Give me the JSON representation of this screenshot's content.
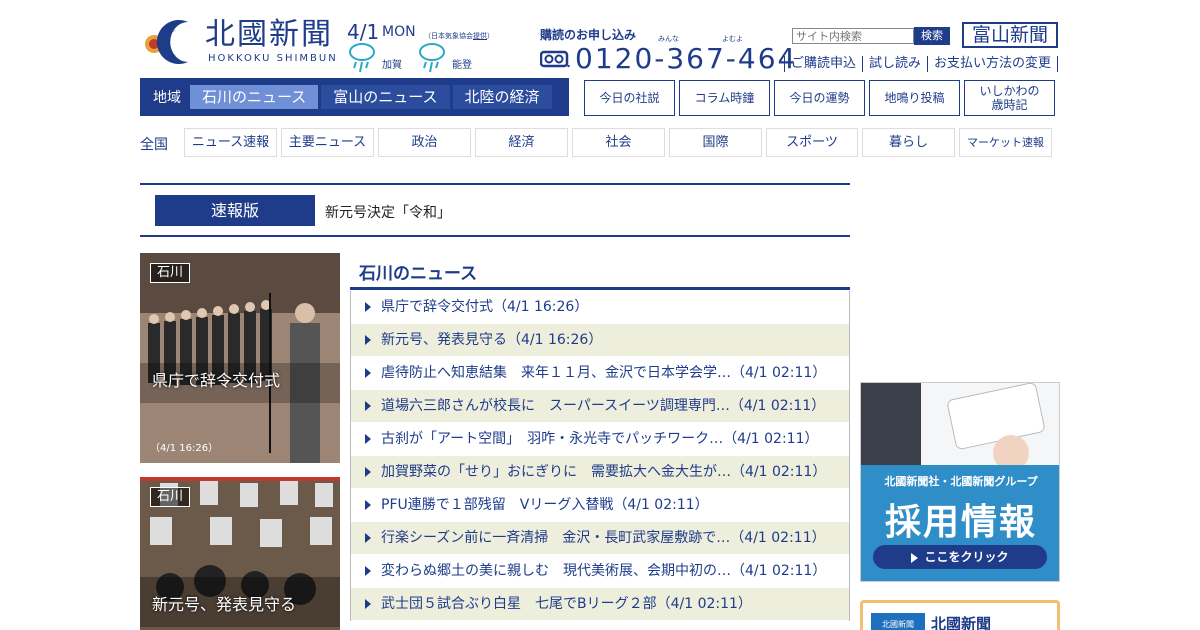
{
  "header": {
    "logo_text": "北國新聞",
    "logo_sub": "HOKKOKU SHIMBUN"
  },
  "weather": {
    "date": "4/1",
    "day": "MON",
    "credit_text": "（日本気象協会",
    "credit_link": "提供",
    "credit_end": "）",
    "areas": [
      {
        "name": "加賀",
        "icon": "rain-icon"
      },
      {
        "name": "能登",
        "icon": "rain-icon"
      }
    ]
  },
  "subscribe": {
    "title": "購読のお申し込み",
    "ruby1": "みんな",
    "ruby2": "よむよ",
    "phone": "0120-367-464"
  },
  "search": {
    "placeholder": "サイト内検索",
    "button": "検索"
  },
  "toyama_button": "富山新聞",
  "top_links": [
    "ご購読申込",
    "試し読み",
    "お支払い方法の変更"
  ],
  "region_nav": {
    "label": "地域",
    "tabs": [
      "石川のニュース",
      "富山のニュース",
      "北陸の経済"
    ]
  },
  "side_buttons": [
    "今日の社説",
    "コラム時鐘",
    "今日の運勢",
    "地鳴り投稿",
    "いしかわの\n歳時記"
  ],
  "category_nav": {
    "all": "全国",
    "items": [
      "ニュース速報",
      "主要ニュース",
      "政治",
      "経済",
      "社会",
      "国際",
      "スポーツ",
      "暮らし",
      "マーケット速報"
    ]
  },
  "breaking": {
    "label": "速報版",
    "text": "新元号決定「令和」"
  },
  "photo_cards": [
    {
      "tag": "石川",
      "caption": "県庁で辞令交付式",
      "time": "（4/1 16:26）"
    },
    {
      "tag": "石川",
      "caption": "新元号、発表見守る",
      "time": ""
    }
  ],
  "news": {
    "title": "石川のニュース",
    "items": [
      "県庁で辞令交付式（4/1 16:26）",
      "新元号、発表見守る（4/1 16:26）",
      "虐待防止へ知恵結集　来年１１月、金沢で日本学会学…（4/1 02:11）",
      "道場六三郎さんが校長に　スーパースイーツ調理専門…（4/1 02:11）",
      "古刹が「アート空間」　羽咋・永光寺でパッチワーク…（4/1 02:11）",
      "加賀野菜の「せり」おにぎりに　需要拡大へ金大生が…（4/1 02:11）",
      "PFU連勝で１部残留　Vリーグ入替戦（4/1 02:11）",
      "行楽シーズン前に一斉清掃　金沢・長町武家屋敷跡で…（4/1 02:11）",
      "変わらぬ郷土の美に親しむ　現代美術展、会期中初の…（4/1 02:11）",
      "武士団５試合ぶり白星　七尾でBリーグ２部（4/1 02:11）"
    ]
  },
  "ad": {
    "line1": "北國新聞社・北國新聞グループ",
    "line2": "採用情報",
    "button": "ここをクリック"
  },
  "ad2": {
    "title": "北國新聞",
    "badge": "北國新聞"
  },
  "colors": {
    "brand": "#1f3c8a",
    "active_tab": "#6f8fd6",
    "row_alt": "#eeeedd"
  }
}
